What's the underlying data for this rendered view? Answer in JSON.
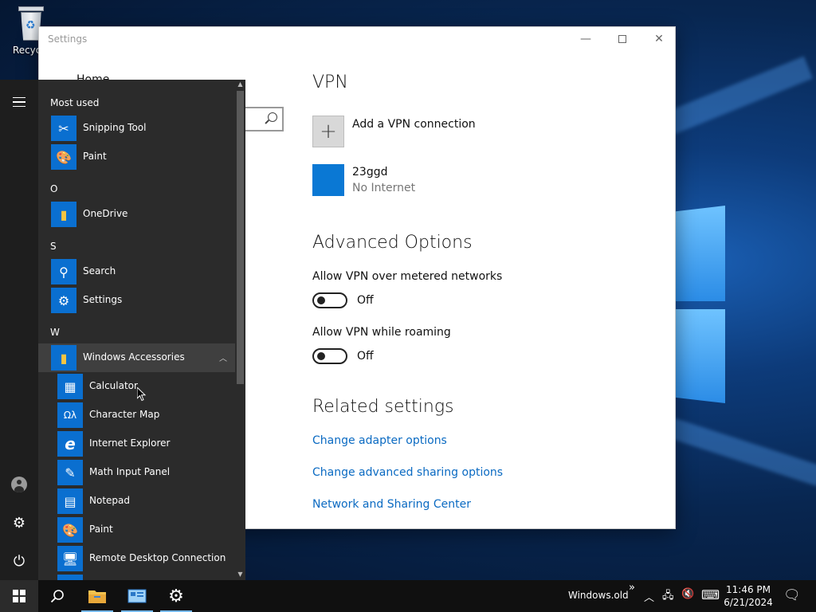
{
  "desktop": {
    "recycle_label": "Recycle"
  },
  "settings": {
    "title": "Settings",
    "sidebar_home": "Home",
    "heading": "VPN",
    "add_vpn_label": "Add a VPN connection",
    "connection": {
      "name": "23ggd",
      "status": "No Internet"
    },
    "advanced_heading": "Advanced Options",
    "options": [
      {
        "label": "Allow VPN over metered networks",
        "state": "Off"
      },
      {
        "label": "Allow VPN while roaming",
        "state": "Off"
      }
    ],
    "related_heading": "Related settings",
    "links": [
      "Change adapter options",
      "Change advanced sharing options",
      "Network and Sharing Center"
    ]
  },
  "start_menu": {
    "most_used_heading": "Most used",
    "most_used": [
      "Snipping Tool",
      "Paint"
    ],
    "group_o": "O",
    "o_apps": [
      "OneDrive"
    ],
    "group_s": "S",
    "s_apps": [
      "Search",
      "Settings"
    ],
    "group_w": "W",
    "w_folder": "Windows Accessories",
    "accessories": [
      "Calculator",
      "Character Map",
      "Internet Explorer",
      "Math Input Panel",
      "Notepad",
      "Paint",
      "Remote Desktop Connection"
    ]
  },
  "taskbar": {
    "toolbar_label": "Windows.old",
    "toolbar_chevron": "»",
    "time": "11:46 PM",
    "date": "6/21/2024"
  }
}
